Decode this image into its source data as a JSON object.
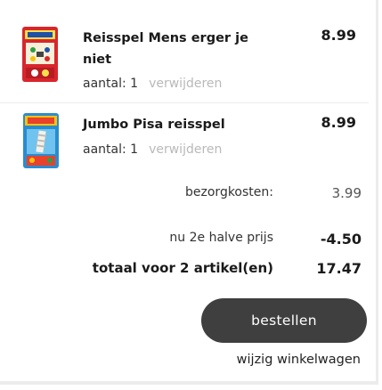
{
  "cart": {
    "items": [
      {
        "name": "Reisspel Mens erger je niet",
        "price": "8.99",
        "qty_label": "aantal: 1",
        "remove_label": "verwijderen",
        "thumb_color": "#d8262c"
      },
      {
        "name": "Jumbo Pisa reisspel",
        "price": "8.99",
        "qty_label": "aantal: 1",
        "remove_label": "verwijderen",
        "thumb_color": "#2a8ccf"
      }
    ],
    "summary": {
      "shipping_label": "bezorgkosten:",
      "shipping_value": "3.99",
      "discount_label": "nu 2e halve prijs",
      "discount_value": "-4.50",
      "total_label": "totaal voor 2 artikel(en)",
      "total_value": "17.47"
    },
    "order_button_label": "bestellen",
    "edit_cart_label": "wijzig winkelwagen",
    "colors": {
      "button_bg": "#3f3f3f",
      "remove_link": "#b9b9b9"
    }
  }
}
